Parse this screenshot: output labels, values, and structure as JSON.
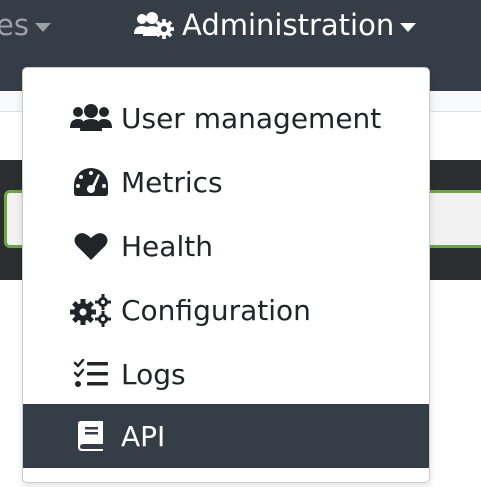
{
  "navbar": {
    "prev_menu_label": "es",
    "admin_label": "Administration"
  },
  "dropdown": {
    "items": [
      {
        "label": "User management",
        "icon": "users-icon"
      },
      {
        "label": "Metrics",
        "icon": "tachometer-icon"
      },
      {
        "label": "Health",
        "icon": "heart-icon"
      },
      {
        "label": "Configuration",
        "icon": "cogs-icon"
      },
      {
        "label": "Logs",
        "icon": "tasks-icon"
      },
      {
        "label": "API",
        "icon": "book-icon",
        "active": true
      }
    ]
  },
  "colors": {
    "navbar_bg": "#353d47",
    "active_item_bg": "#353d47",
    "focus_border": "#6da542"
  }
}
